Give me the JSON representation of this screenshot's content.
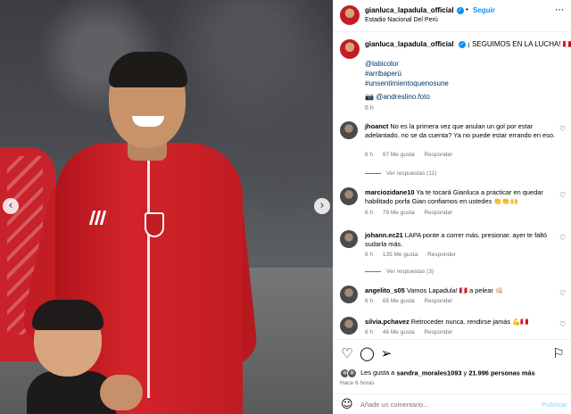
{
  "header": {
    "username": "gianluca_lapadula_official",
    "verified_mark": "✓",
    "separator": "•",
    "follow_label": "Seguir",
    "location": "Estadio Nacional Del Perú",
    "more_icon": "⋯"
  },
  "carousel": {
    "prev_icon": "‹",
    "next_icon": "›"
  },
  "caption": {
    "username": "gianluca_lapadula_official",
    "text": "¡ SEGUIMOS EN LA LUCHA! 🇵🇪",
    "tags": [
      "@labicolor",
      "#arribaperú",
      "#unsentimientoquenosune"
    ],
    "credit_icon": "📷",
    "credit_handle": "@andreslino.foto",
    "time": "6 h"
  },
  "comments": [
    {
      "username": "jhoanct",
      "text": "No es la primera vez que anulan un gol por estar adelantado. no se da cuenta? Ya no puede estar errando en eso.",
      "time": "6 h",
      "likes": "67 Me gusta",
      "reply": "Responder",
      "view_replies": "Ver respuestas (11)"
    },
    {
      "username": "marciozidane10",
      "text": "Ya te tocará Gianluca a practicar en quedar habilitado porfa Gian confiamos en ustedes 👏👏🙌",
      "time": "6 h",
      "likes": "79 Me gusta",
      "reply": "Responder"
    },
    {
      "username": "johann.ec21",
      "text": "LAPA ponte a correr más. presionar. ayer te faltó sudarla más.",
      "time": "6 h",
      "likes": "135 Me gusta",
      "reply": "Responder",
      "view_replies": "Ver respuestas (3)"
    },
    {
      "username": "angelito_s05",
      "text": "Vamos Lapadula! 🇵🇪 a pelear 👊🏻",
      "time": "6 h",
      "likes": "65 Me gusta",
      "reply": "Responder"
    },
    {
      "username": "silvia.pchavez",
      "text": "Retroceder nunca. rendirse jamás 💪🇵🇪",
      "time": "6 h",
      "likes": "46 Me gusta",
      "reply": "Responder"
    }
  ],
  "comment_heart_icon": "♡",
  "actions": {
    "like_icon": "♡",
    "comment_icon": "◯",
    "share_icon": "➢",
    "save_icon": "⚐",
    "likes_prefix": "Les gusta a",
    "likes_user": "sandra_morales1093",
    "likes_join": "y",
    "likes_count": "21.996 personas más",
    "posted": "Hace 6 horas"
  },
  "comment_bar": {
    "emoji_icon": "☺",
    "placeholder": "Añade un comentario...",
    "publish_label": "Publicar"
  }
}
